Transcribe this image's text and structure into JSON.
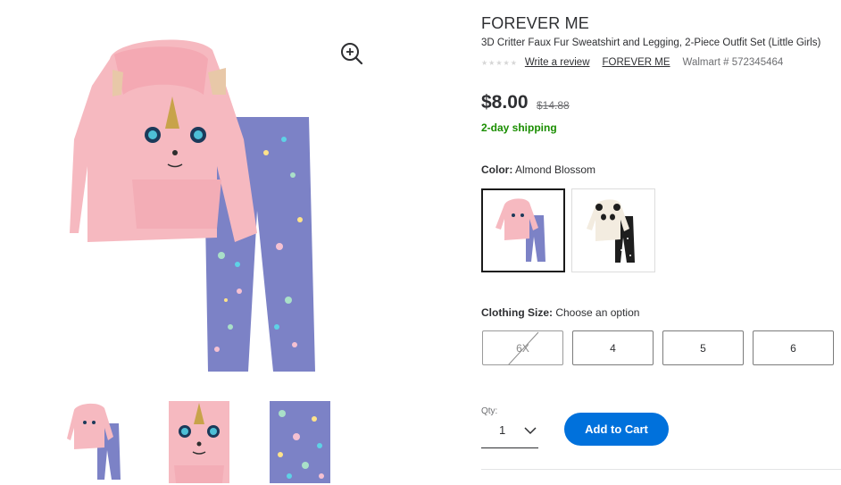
{
  "product": {
    "brand_title": "FOREVER ME",
    "name": "3D Critter Faux Fur Sweatshirt and Legging, 2-Piece Outfit Set (Little Girls)",
    "stars": "★★★★★",
    "rating_value": 0,
    "write_review_label": "Write a review",
    "brand_link": "FOREVER ME",
    "item_number": "Walmart # 572345464"
  },
  "pricing": {
    "price": "$8.00",
    "was_price": "$14.88",
    "shipping": "2-day shipping"
  },
  "color": {
    "label_key": "Color:",
    "selected": "Almond Blossom",
    "swatches": [
      "pink-unicorn-outfit",
      "cream-panda-outfit"
    ]
  },
  "size": {
    "label_key": "Clothing Size:",
    "prompt": "Choose an option",
    "options": [
      {
        "label": "6X",
        "available": false
      },
      {
        "label": "4",
        "available": true
      },
      {
        "label": "5",
        "available": true
      },
      {
        "label": "6",
        "available": true
      }
    ]
  },
  "quantity": {
    "label": "Qty:",
    "value": "1"
  },
  "cart": {
    "add_label": "Add to Cart"
  },
  "icons": {
    "zoom": "zoom-in-icon",
    "qty_chevron": "chevron-down-icon"
  },
  "colors": {
    "accent": "#0071dc",
    "shipping_green": "#1a8e00",
    "hoodie_pink": "#f6b9c0",
    "legging_blue": "#7c82c6"
  }
}
